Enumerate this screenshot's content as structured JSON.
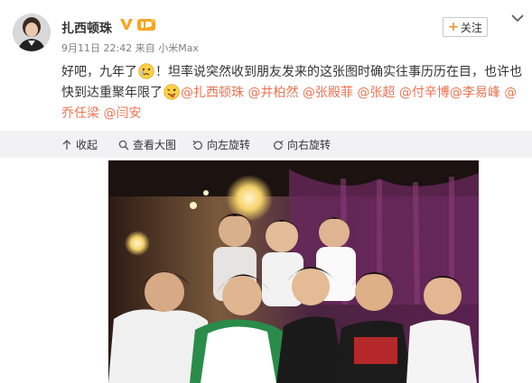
{
  "user": {
    "name": "扎西顿珠"
  },
  "meta": {
    "date": "9月11日 22:42",
    "source_prefix": "来自",
    "source": "小米Max"
  },
  "follow": {
    "plus": "+",
    "label": "关注"
  },
  "post": {
    "seg1": "好吧，九年了",
    "seg2": "！坦率说突然收到朋友发来的这张图时确实往事历历在目，也许也快到达重聚年限了",
    "mentions": [
      "@扎西顿珠",
      "@井柏然",
      "@张殿菲",
      "@张超",
      "@付辛博",
      "@李易峰",
      "@乔任梁",
      "@闫安"
    ]
  },
  "actions": {
    "collapse": "收起",
    "view_large": "查看大图",
    "rotate_left": "向左旋转",
    "rotate_right": "向右旋转"
  },
  "icons": {
    "avatar": "user-avatar",
    "verified": "verified-v-icon",
    "vip": "vip-badge-icon",
    "more": "chevron-down-icon",
    "emoji1": "crying-emoji-icon",
    "emoji2": "tongue-emoji-icon",
    "collapse": "arrow-up-icon",
    "view_large": "magnifier-icon",
    "rotate_left": "rotate-left-icon",
    "rotate_right": "rotate-right-icon"
  },
  "colors": {
    "mention": "#eb7350",
    "badge_orange": "#f6a623",
    "action_bar": "#f2f2f5",
    "meta_text": "#808080"
  }
}
